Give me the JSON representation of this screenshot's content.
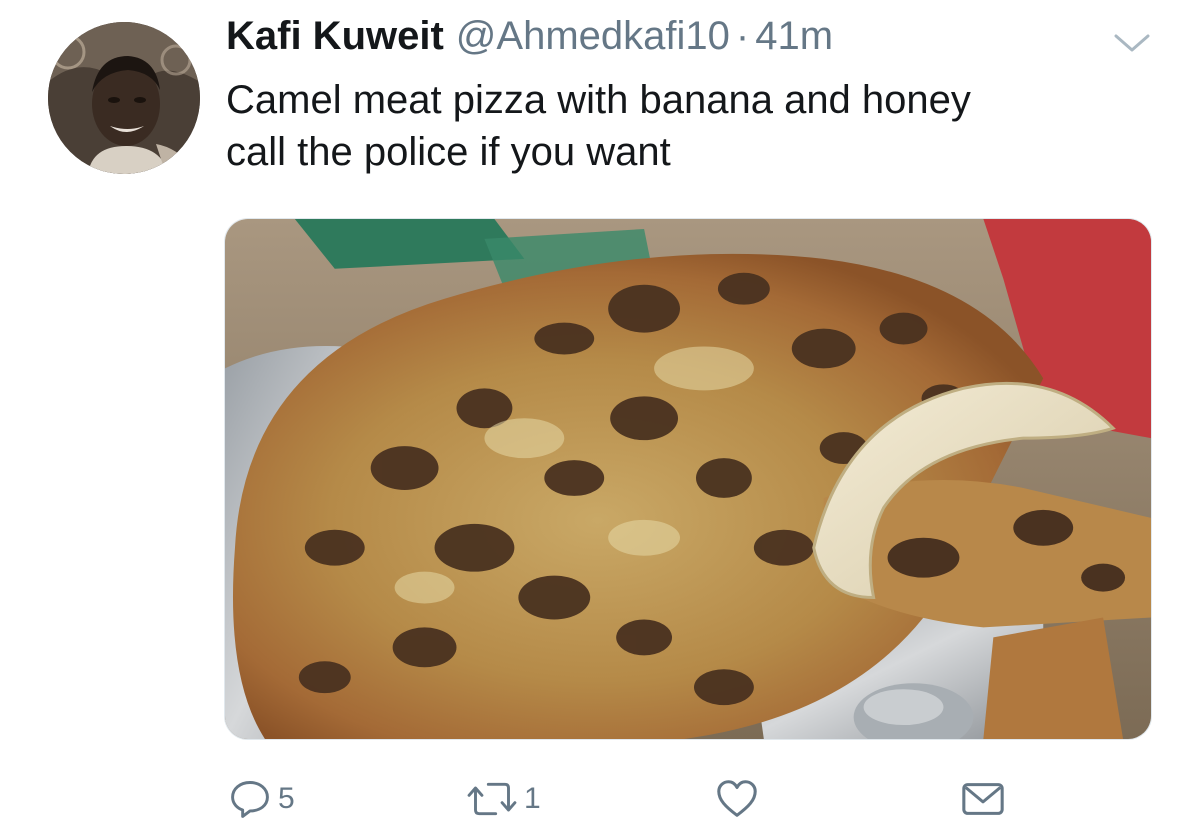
{
  "tweet": {
    "author": {
      "display_name": "Kafi Kuweit",
      "handle": "@Ahmedkafi10"
    },
    "separator": "·",
    "time": "41m",
    "text_lines": [
      "Camel meat pizza with banana and honey",
      "call the police if you want"
    ],
    "media": {
      "description_icon": "photo"
    }
  },
  "actions": {
    "reply": {
      "icon": "reply-icon",
      "count": "5"
    },
    "retweet": {
      "icon": "retweet-icon",
      "count": "1"
    },
    "like": {
      "icon": "heart-icon",
      "count": ""
    },
    "message": {
      "icon": "envelope-icon"
    }
  },
  "colors": {
    "text": "#14171a",
    "secondary": "#657786"
  }
}
